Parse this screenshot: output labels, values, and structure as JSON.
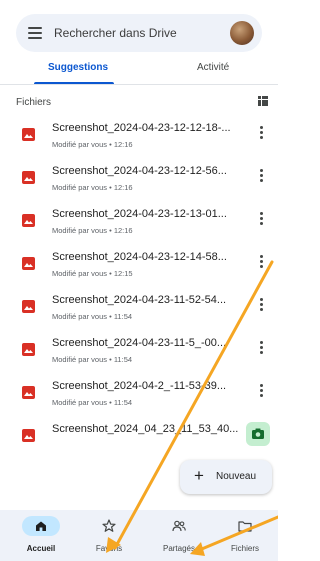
{
  "search": {
    "placeholder": "Rechercher dans Drive"
  },
  "tabs": [
    {
      "label": "Suggestions",
      "active": true
    },
    {
      "label": "Activité",
      "active": false
    }
  ],
  "section": {
    "title": "Fichiers"
  },
  "files": [
    {
      "name": "Screenshot_2024-04-23-12-12-18-...",
      "meta": "Modifié par vous • 12:16"
    },
    {
      "name": "Screenshot_2024-04-23-12-12-56...",
      "meta": "Modifié par vous • 12:16"
    },
    {
      "name": "Screenshot_2024-04-23-12-13-01...",
      "meta": "Modifié par vous • 12:16"
    },
    {
      "name": "Screenshot_2024-04-23-12-14-58...",
      "meta": "Modifié par vous • 12:15"
    },
    {
      "name": "Screenshot_2024-04-23-11-52-54...",
      "meta": "Modifié par vous • 11:54"
    },
    {
      "name": "Screenshot_2024-04-23-11-5_-00...",
      "meta": "Modifié par vous • 11:54"
    },
    {
      "name": "Screenshot_2024-04-2_-11-53-39...",
      "meta": "Modifié par vous • 11:54"
    },
    {
      "name": "Screenshot_2024_04_23_11_53_40...",
      "meta": ""
    }
  ],
  "fab": {
    "new_label": "Nouveau"
  },
  "bottom_nav": [
    {
      "label": "Accueil",
      "icon": "home-icon",
      "active": true
    },
    {
      "label": "Favoris",
      "icon": "star-icon",
      "active": false
    },
    {
      "label": "Partagés",
      "icon": "people-icon",
      "active": false
    },
    {
      "label": "Fichiers",
      "icon": "folder-icon",
      "active": false
    }
  ],
  "colors": {
    "accent": "#0b57d0",
    "file_icon": "#d93025",
    "nav_active_pill": "#c2e7ff",
    "annotation_arrow": "#f5a623",
    "scan_fab": "#c4eed0"
  }
}
